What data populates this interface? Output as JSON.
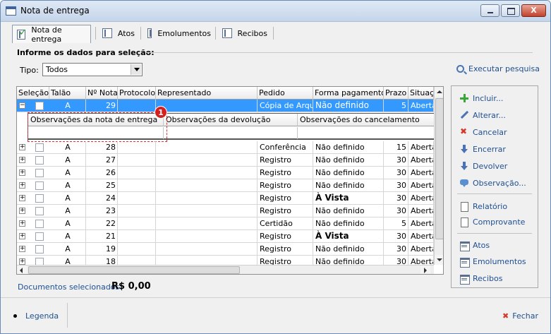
{
  "window": {
    "title": "Nota de entrega",
    "close_glyph": "X"
  },
  "tabs": [
    {
      "label": "Nota de entrega",
      "icon": "check-document-icon",
      "active": true
    },
    {
      "label": "Atos",
      "icon": "book-icon"
    },
    {
      "label": "Emolumentos",
      "icon": "book-icon"
    },
    {
      "label": "Recibos",
      "icon": "book-icon"
    }
  ],
  "selection": {
    "title": "Informe os dados para seleção:",
    "tipo_label": "Tipo:",
    "tipo_value": "Todos",
    "execute_label": "Executar pesquisa"
  },
  "grid": {
    "columns": [
      "Seleção",
      "Talão",
      "Nº Nota",
      "Protocolo",
      "Representado",
      "Pedido",
      "Forma pagamento",
      "Prazo",
      "Situação"
    ],
    "selected_row": {
      "expander": "−",
      "talao": "A",
      "nota": "29",
      "protocolo": "",
      "representado": "",
      "pedido": "Cópia de Arquivo",
      "forma": "Não definido",
      "prazo": "5",
      "situacao": "Aberta"
    },
    "subgrid_columns": [
      "Observações da nota de entrega",
      "Observações da devolução",
      "Observações do cancelamento"
    ],
    "callout_number": "1",
    "rows": [
      {
        "expander": "+",
        "talao": "A",
        "nota": "28",
        "pedido": "Conferência",
        "forma": "Não definido",
        "prazo": "15",
        "situacao": "Aberta",
        "bold": false
      },
      {
        "expander": "+",
        "talao": "A",
        "nota": "27",
        "pedido": "Registro",
        "forma": "Não definido",
        "prazo": "30",
        "situacao": "Aberta",
        "bold": false
      },
      {
        "expander": "+",
        "talao": "A",
        "nota": "26",
        "pedido": "Registro",
        "forma": "Não definido",
        "prazo": "30",
        "situacao": "Aberta",
        "bold": false
      },
      {
        "expander": "+",
        "talao": "A",
        "nota": "25",
        "pedido": "Registro",
        "forma": "Não definido",
        "prazo": "30",
        "situacao": "Aberta",
        "bold": false
      },
      {
        "expander": "+",
        "talao": "A",
        "nota": "24",
        "pedido": "Registro",
        "forma": "À Vista",
        "prazo": "30",
        "situacao": "Aberta",
        "bold": true
      },
      {
        "expander": "+",
        "talao": "A",
        "nota": "23",
        "pedido": "Registro",
        "forma": "Não definido",
        "prazo": "30",
        "situacao": "Aberta",
        "bold": false
      },
      {
        "expander": "+",
        "talao": "A",
        "nota": "22",
        "pedido": "Certidão",
        "forma": "Não definido",
        "prazo": "5",
        "situacao": "Aberta",
        "bold": false
      },
      {
        "expander": "+",
        "talao": "A",
        "nota": "21",
        "pedido": "Registro",
        "forma": "À Vista",
        "prazo": "30",
        "situacao": "Aberta",
        "bold": true
      },
      {
        "expander": "+",
        "talao": "A",
        "nota": "19",
        "pedido": "Registro",
        "forma": "Não definido",
        "prazo": "30",
        "situacao": "Aberta",
        "bold": false
      },
      {
        "expander": "+",
        "talao": "A",
        "nota": "18",
        "pedido": "Registro",
        "forma": "Não definido",
        "prazo": "30",
        "situacao": "Aberta",
        "bold": false
      }
    ]
  },
  "summary": {
    "label": "Documentos selecionados:",
    "value": "R$ 0,00"
  },
  "actions": {
    "group1": [
      {
        "label": "Incluir...",
        "icon": "plus-icon",
        "name": "incluir-button"
      },
      {
        "label": "Alterar...",
        "icon": "pencil-icon",
        "name": "alterar-button"
      },
      {
        "label": "Cancelar",
        "icon": "x-icon",
        "name": "cancelar-button"
      },
      {
        "label": "Encerrar",
        "icon": "arrow-down-icon",
        "name": "encerrar-button"
      },
      {
        "label": "Devolver",
        "icon": "arrow-down-icon",
        "name": "devolver-button"
      },
      {
        "label": "Observação...",
        "icon": "chat-icon",
        "name": "observacao-button"
      }
    ],
    "group2": [
      {
        "label": "Relatório",
        "icon": "document-icon",
        "name": "relatorio-button"
      },
      {
        "label": "Comprovante",
        "icon": "document-icon",
        "name": "comprovante-button"
      }
    ],
    "group3": [
      {
        "label": "Atos",
        "icon": "list-icon",
        "name": "atos-button"
      },
      {
        "label": "Emolumentos",
        "icon": "list-icon",
        "name": "emolumentos-button"
      },
      {
        "label": "Recibos",
        "icon": "list-icon",
        "name": "recibos-button"
      }
    ]
  },
  "footer": {
    "legenda": "Legenda",
    "fechar": "Fechar",
    "fechar_glyph": "✖"
  },
  "colors": {
    "selection": "#3399ff",
    "link": "#1f4f91",
    "callout": "#d42020"
  }
}
